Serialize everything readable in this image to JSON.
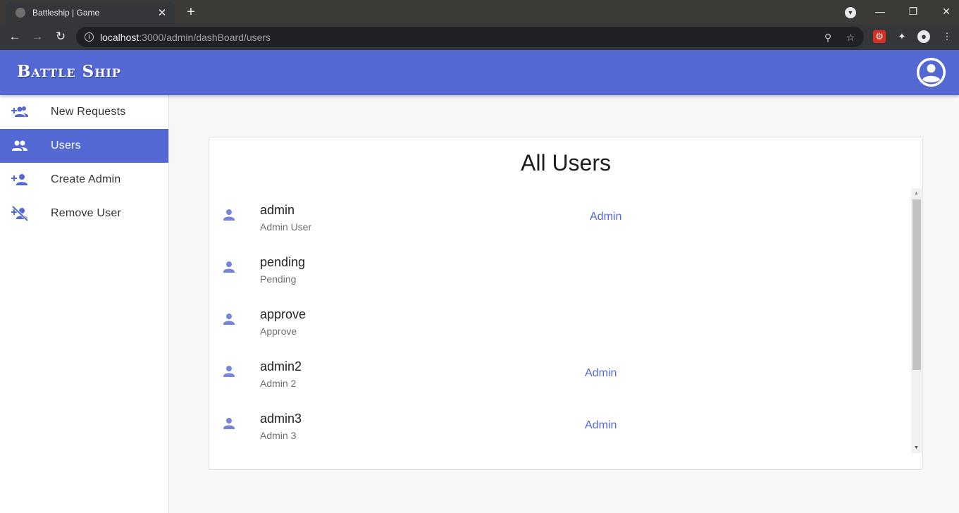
{
  "browser": {
    "tab_title": "Battleship | Game",
    "tab_close": "✕",
    "new_tab": "+",
    "url_host": "localhost",
    "url_rest": ":3000/admin/dashBoard/users"
  },
  "app": {
    "brand": "Battle Ship",
    "accent_color": "#5468d4"
  },
  "sidebar": {
    "items": [
      {
        "label": "New Requests",
        "icon": "group-add-icon",
        "active": false
      },
      {
        "label": "Users",
        "icon": "people-icon",
        "active": true
      },
      {
        "label": "Create Admin",
        "icon": "person-add-icon",
        "active": false
      },
      {
        "label": "Remove User",
        "icon": "person-remove-icon",
        "active": false
      }
    ]
  },
  "main": {
    "title": "All Users",
    "users": [
      {
        "name": "admin",
        "subtitle": "Admin User",
        "role": "Admin"
      },
      {
        "name": "pending",
        "subtitle": "Pending",
        "role": ""
      },
      {
        "name": "approve",
        "subtitle": "Approve",
        "role": ""
      },
      {
        "name": "admin2",
        "subtitle": "Admin 2",
        "role": "Admin"
      },
      {
        "name": "admin3",
        "subtitle": "Admin 3",
        "role": "Admin"
      }
    ]
  }
}
